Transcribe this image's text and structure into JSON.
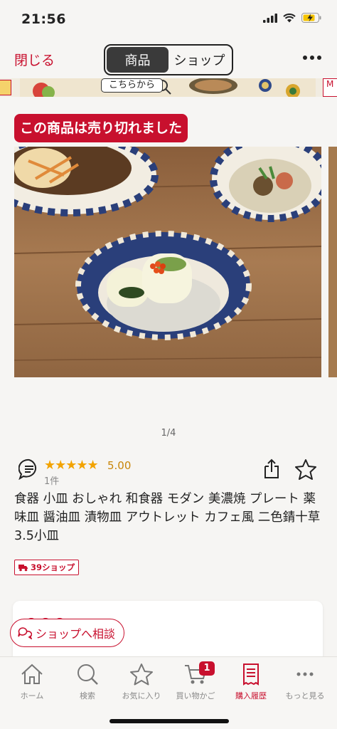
{
  "status": {
    "time": "21:56"
  },
  "header": {
    "close_label": "閉じる",
    "tabs": [
      {
        "label": "商品",
        "active": true
      },
      {
        "label": "ショップ",
        "active": false
      }
    ]
  },
  "banner": {
    "button_label": "こちらから",
    "right_text": "M"
  },
  "product": {
    "soldout_label": "この商品は売り切れました",
    "image_counter": "1/4",
    "stars": "★★★★★",
    "rating": "5.00",
    "review_count": "1件",
    "title": "食器 小皿 おしゃれ 和食器 モダン 美濃焼 プレート 薬味皿 醤油皿 漬物皿 アウトレット カフェ風 二色錆十草3.5小皿",
    "shop_badge": "39ショップ"
  },
  "consult_button": "ショップへ相談",
  "tabbar": {
    "items": [
      {
        "label": "ホーム",
        "icon": "home-icon"
      },
      {
        "label": "検索",
        "icon": "search-icon"
      },
      {
        "label": "お気に入り",
        "icon": "star-icon"
      },
      {
        "label": "買い物かご",
        "icon": "cart-icon",
        "badge": "1"
      },
      {
        "label": "購入履歴",
        "icon": "receipt-icon",
        "active": true
      },
      {
        "label": "もっと見る",
        "icon": "more-icon"
      }
    ]
  },
  "colors": {
    "accent": "#c8102e",
    "star": "#f2a300",
    "background": "#f6f5f3"
  }
}
